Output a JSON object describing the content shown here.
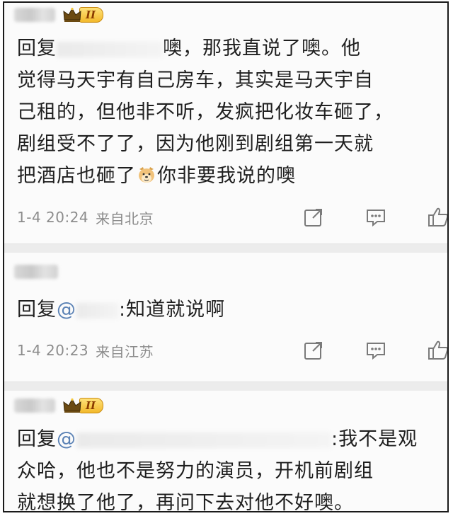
{
  "comments": [
    {
      "level": "II",
      "reply_prefix": "回复",
      "line1_tail": "噢，那我直说了噢。他",
      "line2": "觉得马天宇有自己房车，其实是马天宇自",
      "line3": "己租的，但他非不听，发疯把化妆车砸了，",
      "line4": "剧组受不了了，因为他刚到剧组第一天就",
      "line5_a": "把酒店也砸了",
      "line5_b": "你非要我说的噢",
      "time": "1-4 20:24",
      "location": "来自北京"
    },
    {
      "reply_prefix": "回复",
      "at": "@",
      "body": ":知道就说啊",
      "time": "1-4 20:23",
      "location": "来自江苏"
    },
    {
      "level": "II",
      "reply_prefix": "回复",
      "at": "@",
      "line1_tail": ":我不是观",
      "line2": "众哈，他也不是努力的演员，开机前剧组",
      "line3": "就想换了他了，再问下去对他不好噢。"
    }
  ],
  "icons": {
    "share": "share-icon",
    "comment": "comment-icon",
    "like": "thumbs-up-icon",
    "crown": "crown-icon",
    "emoji": "doge-emoji-icon"
  },
  "colors": {
    "mention": "#5b82b5",
    "meta": "#8c8c8c",
    "badge": "#f2b92b"
  }
}
